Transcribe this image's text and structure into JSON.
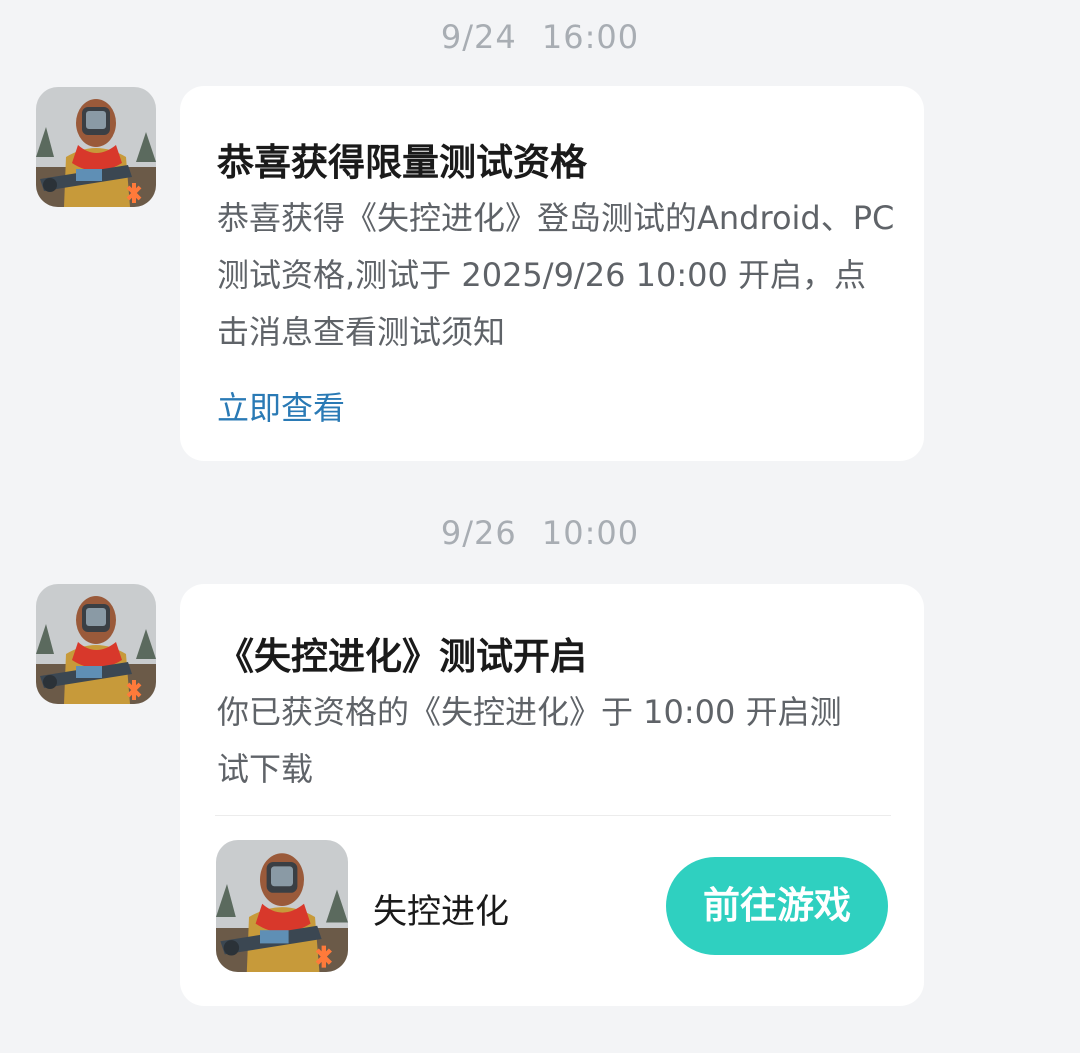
{
  "messages": [
    {
      "timestamp": "9/24  16:00",
      "title": "恭喜获得限量测试资格",
      "body": "恭喜获得《失控进化》登岛测试的Android、PC测试资格,测试于 2025/9/26 10:00 开启，点击消息查看测试须知",
      "link_label": "立即查看",
      "avatar_icon": "game-character-icon"
    },
    {
      "timestamp": "9/26  10:00",
      "title": "《失控进化》测试开启",
      "body": "你已获资格的《失控进化》于 10:00 开启测试下载",
      "game": {
        "name": "失控进化",
        "icon": "game-character-icon",
        "button_label": "前往游戏"
      },
      "avatar_icon": "game-character-icon"
    }
  ],
  "colors": {
    "background": "#f3f4f6",
    "card": "#ffffff",
    "link": "#2a7ab5",
    "button": "#2fd0c0",
    "timestamp": "#a8adb3"
  }
}
